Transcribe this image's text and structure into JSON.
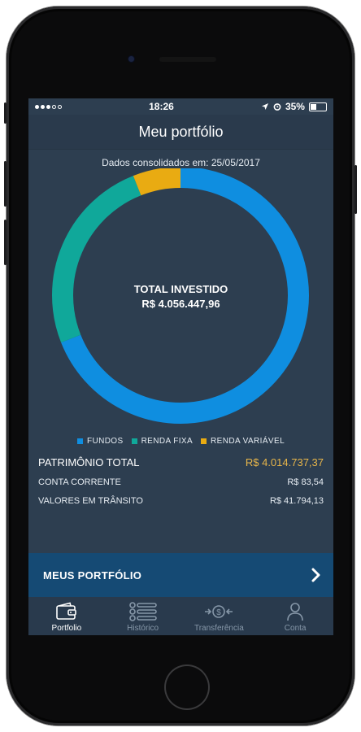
{
  "status_bar": {
    "time": "18:26",
    "battery": "35%"
  },
  "header": {
    "title": "Meu portfólio"
  },
  "consolidated": {
    "text": "Dados consolidados em: 25/05/2017"
  },
  "chart_data": {
    "type": "pie",
    "style": "donut",
    "categories": [
      "FUNDOS",
      "RENDA FIXA",
      "RENDA VARIÁVEL"
    ],
    "values": [
      69,
      25,
      6
    ],
    "colors": [
      "#0f8ee0",
      "#10a89a",
      "#e9ab12"
    ],
    "center_title": "TOTAL INVESTIDO",
    "center_value": "R$ 4.056.447,96",
    "legend_position": "bottom"
  },
  "summary": {
    "total_label": "PATRIMÔNIO TOTAL",
    "total_value": "R$ 4.014.737,37",
    "rows": [
      {
        "label": "CONTA CORRENTE",
        "value": "R$ 83,54"
      },
      {
        "label": "VALORES EM TRÂNSITO",
        "value": "R$ 41.794,13"
      }
    ]
  },
  "cta": {
    "label": "MEUS PORTFÓLIO"
  },
  "tabs": [
    {
      "label": "Portfolio",
      "icon": "wallet-icon",
      "active": true
    },
    {
      "label": "Histórico",
      "icon": "list-icon",
      "active": false
    },
    {
      "label": "Transferência",
      "icon": "transfer-icon",
      "active": false
    },
    {
      "label": "Conta",
      "icon": "user-icon",
      "active": false
    }
  ],
  "colors": {
    "background": "#2d3e50",
    "accent_gold": "#e8b64a",
    "cta_background": "#154a74"
  }
}
